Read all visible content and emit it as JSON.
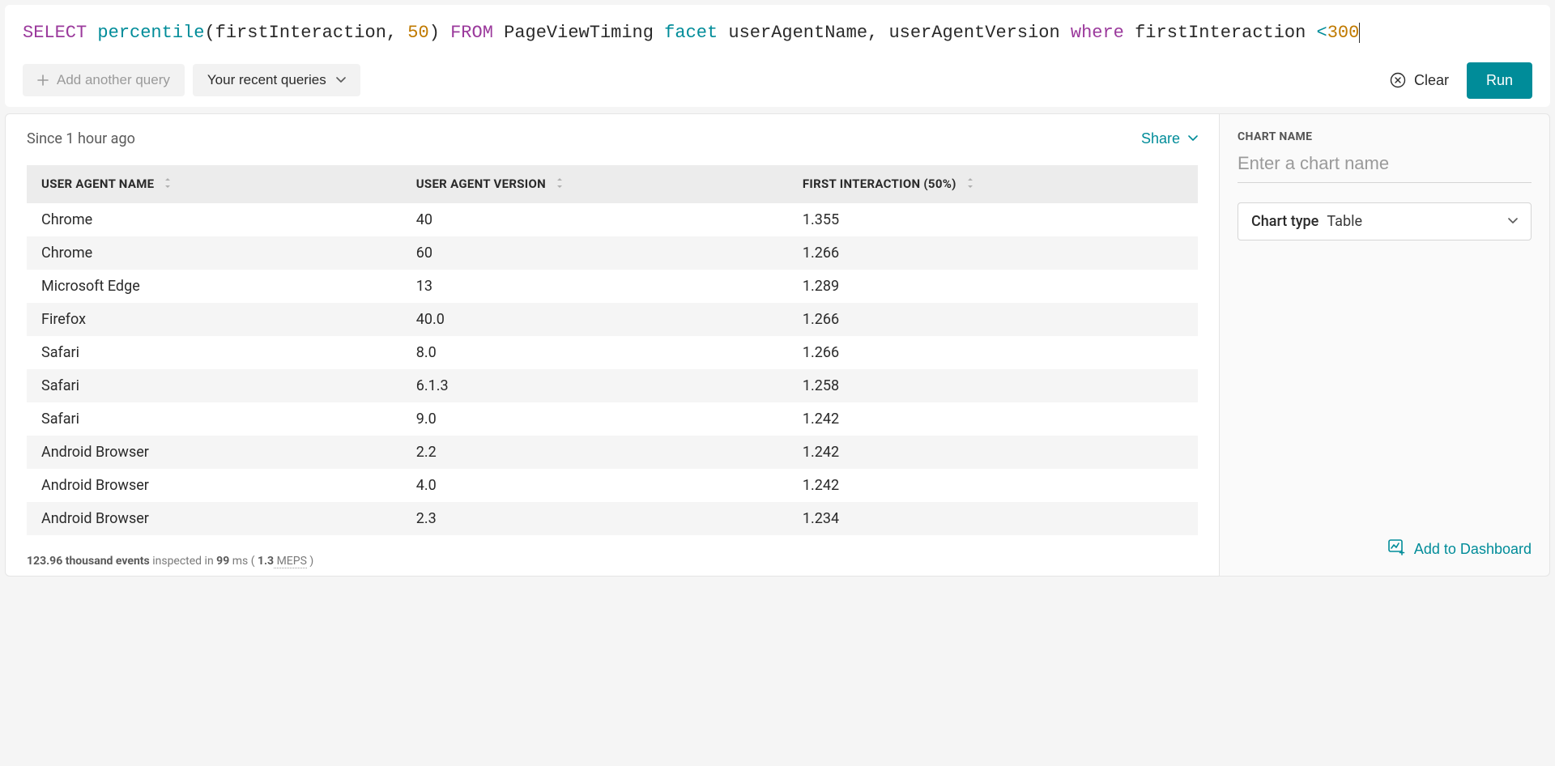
{
  "query": {
    "tokens": {
      "select": "SELECT",
      "percentile": "percentile",
      "open": "(",
      "arg1": "firstInteraction",
      "comma": ",",
      "arg2": "50",
      "close": ")",
      "from": "FROM",
      "table": "PageViewTiming",
      "facet": "facet",
      "facet_arg1": "userAgentName",
      "comma2": ",",
      "facet_arg2": "userAgentVersion",
      "where": "where",
      "where_field": "firstInteraction",
      "lt": "<",
      "where_value": "300"
    }
  },
  "toolbar": {
    "add_query": "Add another query",
    "recent_queries": "Your recent queries",
    "clear": "Clear",
    "run": "Run"
  },
  "results": {
    "since": "Since 1 hour ago",
    "share": "Share",
    "columns": [
      "USER AGENT NAME",
      "USER AGENT VERSION",
      "FIRST INTERACTION (50%)"
    ],
    "rows": [
      {
        "c0": "Chrome",
        "c1": "40",
        "c2": "1.355"
      },
      {
        "c0": "Chrome",
        "c1": "60",
        "c2": "1.266"
      },
      {
        "c0": "Microsoft Edge",
        "c1": "13",
        "c2": "1.289"
      },
      {
        "c0": "Firefox",
        "c1": "40.0",
        "c2": "1.266"
      },
      {
        "c0": "Safari",
        "c1": "8.0",
        "c2": "1.266"
      },
      {
        "c0": "Safari",
        "c1": "6.1.3",
        "c2": "1.258"
      },
      {
        "c0": "Safari",
        "c1": "9.0",
        "c2": "1.242"
      },
      {
        "c0": "Android Browser",
        "c1": "2.2",
        "c2": "1.242"
      },
      {
        "c0": "Android Browser",
        "c1": "4.0",
        "c2": "1.242"
      },
      {
        "c0": "Android Browser",
        "c1": "2.3",
        "c2": "1.234"
      }
    ],
    "footer": {
      "events": "123.96 thousand events",
      "inspected": " inspected in ",
      "ms": "99",
      "ms_unit": " ms ( ",
      "meps_num": "1.3",
      "meps_label": " MEPS",
      "close": " )"
    }
  },
  "side": {
    "chart_name_label": "CHART NAME",
    "chart_name_placeholder": "Enter a chart name",
    "chart_type_label": "Chart type",
    "chart_type_value": "Table",
    "add_dashboard": "Add to Dashboard"
  },
  "chart_data": {
    "type": "table",
    "columns": [
      "User Agent Name",
      "User Agent Version",
      "First Interaction (50%)"
    ],
    "rows": [
      [
        "Chrome",
        "40",
        1.355
      ],
      [
        "Chrome",
        "60",
        1.266
      ],
      [
        "Microsoft Edge",
        "13",
        1.289
      ],
      [
        "Firefox",
        "40.0",
        1.266
      ],
      [
        "Safari",
        "8.0",
        1.266
      ],
      [
        "Safari",
        "6.1.3",
        1.258
      ],
      [
        "Safari",
        "9.0",
        1.242
      ],
      [
        "Android Browser",
        "2.2",
        1.242
      ],
      [
        "Android Browser",
        "4.0",
        1.242
      ],
      [
        "Android Browser",
        "2.3",
        1.234
      ]
    ]
  }
}
